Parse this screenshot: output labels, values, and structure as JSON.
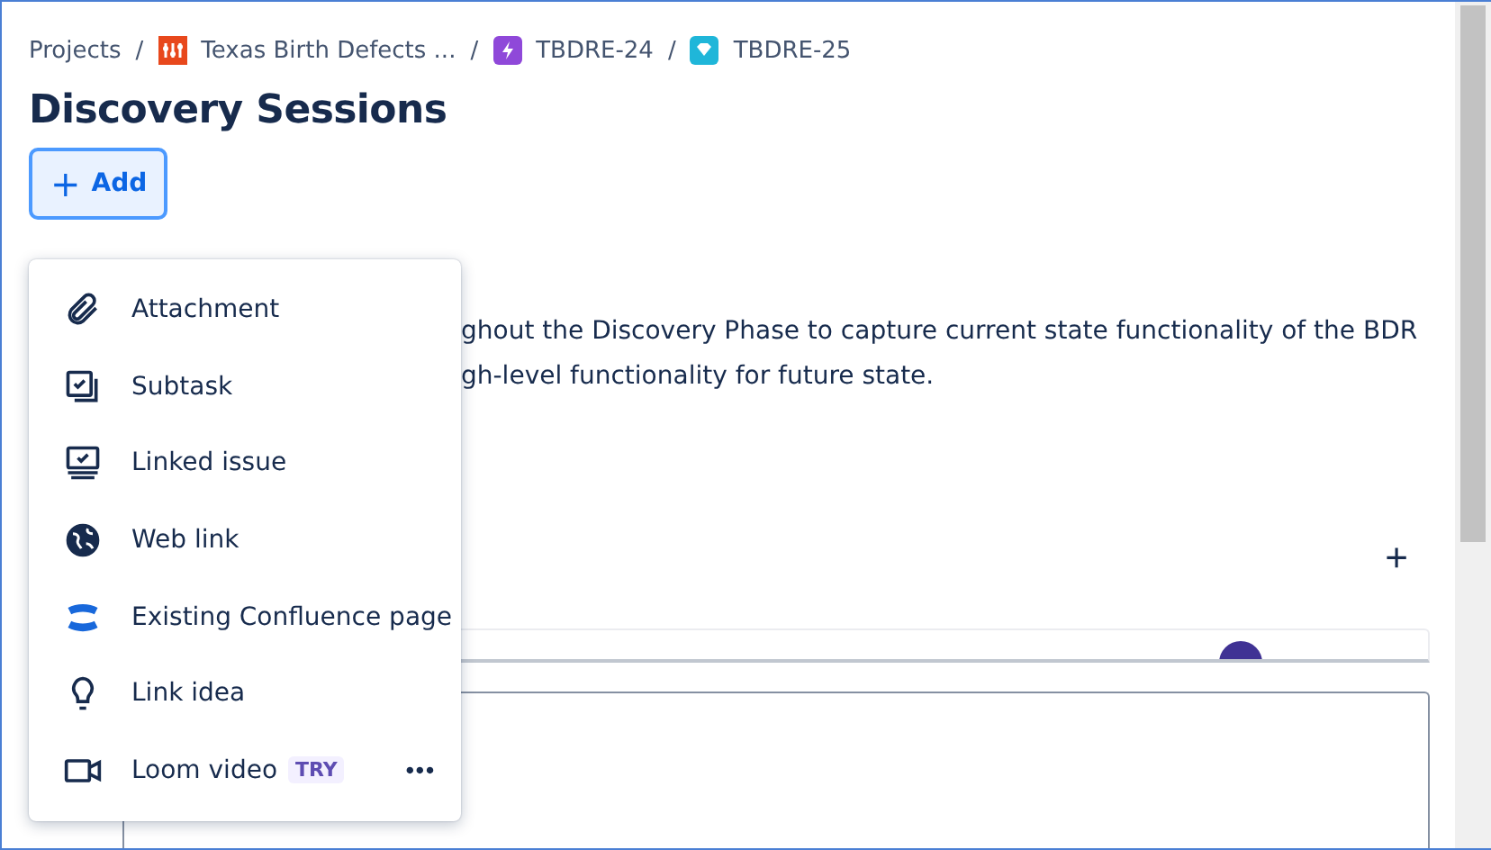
{
  "breadcrumbs": [
    {
      "label": "Projects"
    },
    {
      "label": "Texas Birth Defects ..."
    },
    {
      "label": "TBDRE-24"
    },
    {
      "label": "TBDRE-25"
    }
  ],
  "separator": "/",
  "title": "Discovery Sessions",
  "add_button": {
    "icon": "+",
    "label": "Add"
  },
  "description": [
    "ghout the Discovery Phase to capture current state functionality of the BDR",
    "gh-level functionality for future state."
  ],
  "section_add": "+",
  "menu": [
    {
      "label": "Attachment"
    },
    {
      "label": "Subtask"
    },
    {
      "label": "Linked issue"
    },
    {
      "label": "Web link"
    },
    {
      "label": "Existing Confluence page"
    },
    {
      "label": "Link idea"
    },
    {
      "label": "Loom video",
      "badge": "TRY",
      "more": "•••"
    }
  ]
}
